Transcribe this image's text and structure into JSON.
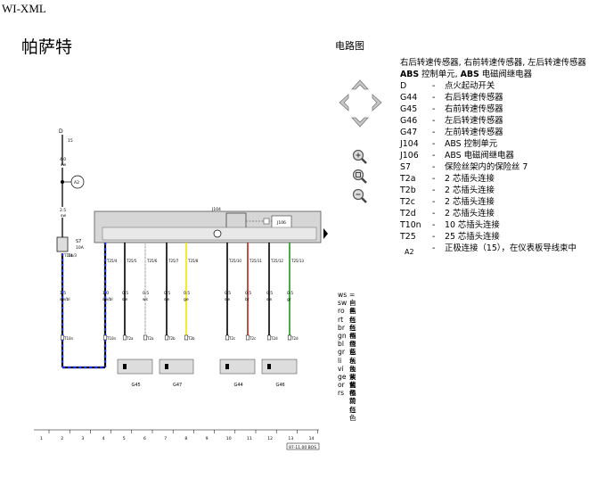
{
  "header": {
    "title": "WI-XML"
  },
  "brand": "帕萨特",
  "section_title": "电路图",
  "nav": {
    "icons": [
      "pan-up-icon",
      "pan-left-icon",
      "pan-right-icon",
      "pan-down-icon",
      "zoom-in-icon",
      "zoom-fit-icon",
      "zoom-out-icon"
    ]
  },
  "legend": {
    "head1": "右后转速传感器, 右前转速传感器, 左后转速传感器",
    "head2_a": "ABS",
    "head2_b": " 控制单元, ",
    "head2_c": "ABS",
    "head2_d": " 电磁阀继电器",
    "items": [
      {
        "code": "D",
        "desc": "点火起动开关"
      },
      {
        "code": "G44",
        "desc": "右后转速传感器"
      },
      {
        "code": "G45",
        "desc": "右前转速传感器"
      },
      {
        "code": "G46",
        "desc": "左后转速传感器"
      },
      {
        "code": "G47",
        "desc": "左前转速传感器"
      },
      {
        "code": "J104",
        "desc": "ABS 控制单元"
      },
      {
        "code": "J106",
        "desc": "ABS 电磁阀继电器"
      },
      {
        "code": "S7",
        "desc": "保险丝架内的保险丝 7"
      },
      {
        "code": "T2a",
        "desc": "2 芯插头连接"
      },
      {
        "code": "T2b",
        "desc": "2 芯插头连接"
      },
      {
        "code": "T2c",
        "desc": "2 芯插头连接"
      },
      {
        "code": "T2d",
        "desc": "2 芯插头连接"
      },
      {
        "code": "T10n",
        "desc": "10 芯插头连接"
      },
      {
        "code": "T25",
        "desc": "25 芯插头连接"
      },
      {
        "code": "A2",
        "desc": "正极连接（15），在仪表板导线束中"
      }
    ],
    "dash": "-"
  },
  "colors_list": [
    {
      "c": "ws",
      "d": "白色"
    },
    {
      "c": "sw",
      "d": "黑色"
    },
    {
      "c": "ro",
      "d": "红色"
    },
    {
      "c": "rt",
      "d": "红色"
    },
    {
      "c": "br",
      "d": "褐色"
    },
    {
      "c": "gn",
      "d": "绿色"
    },
    {
      "c": "bl",
      "d": "蓝色"
    },
    {
      "c": "gr",
      "d": "灰色"
    },
    {
      "c": "li",
      "d": "淡紫色"
    },
    {
      "c": "vi",
      "d": "淡紫色"
    },
    {
      "c": "ge",
      "d": "黄色"
    },
    {
      "c": "or",
      "d": "橘黄色"
    },
    {
      "c": "rs",
      "d": "粉红色"
    }
  ],
  "colors_dash": "=",
  "diagram": {
    "d_label": "D",
    "d_pin": "15",
    "w1": "4.0",
    "w1c": "sw",
    "a2": "A2",
    "w2": "2.5",
    "w2c": "sw",
    "fuse": "S7",
    "fuse_amp": "10A",
    "t4": "T4",
    "j104": "J104",
    "j106": "J106",
    "wires": [
      {
        "w": "1.5",
        "c": "sw/bl",
        "pin": "T10n/3"
      },
      {
        "w": "1.0",
        "c": "sw/bl",
        "pin": "T25/4"
      },
      {
        "w": "0.5",
        "c": "sw",
        "pin": "T25/5"
      },
      {
        "w": "0.5",
        "c": "ws",
        "pin": "T25/6"
      },
      {
        "w": "0.5",
        "c": "sw",
        "pin": "T25/7"
      },
      {
        "w": "0.5",
        "c": "ge",
        "pin": "T25/8"
      },
      {
        "w": "0.5",
        "c": "sw",
        "pin": "T25/10"
      },
      {
        "w": "0.5",
        "c": "br",
        "pin": "T25/11"
      },
      {
        "w": "0.5",
        "c": "sw",
        "pin": "T25/12"
      },
      {
        "w": "0.5",
        "c": "gr",
        "pin": "T25/13"
      }
    ],
    "conn": [
      "T10n",
      "T2a",
      "T2a",
      "T2b",
      "T2b",
      "T2c",
      "T2c",
      "T2d",
      "T2d"
    ],
    "sensors": [
      "G45",
      "G47",
      "G44",
      "G46"
    ],
    "scale": [
      "1",
      "2",
      "3",
      "4",
      "5",
      "6",
      "7",
      "8",
      "9",
      "10",
      "11",
      "12",
      "13",
      "14"
    ],
    "doc_no": "97-11.00 BOS"
  }
}
